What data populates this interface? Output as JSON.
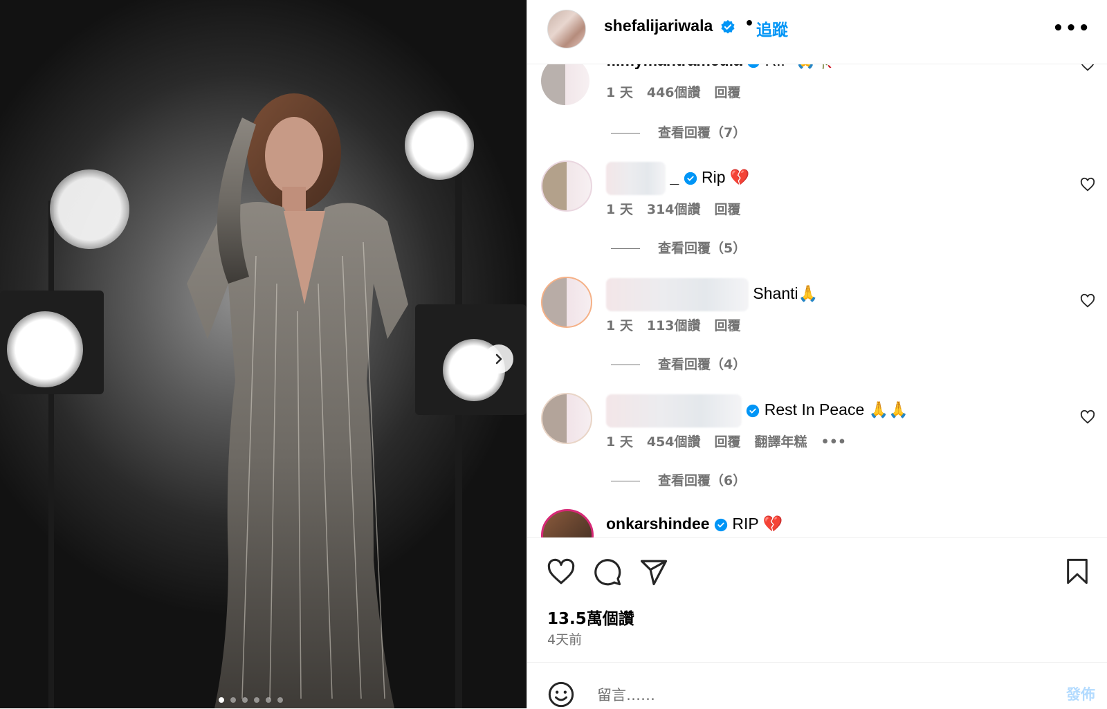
{
  "post": {
    "owner": "shefalijariwala",
    "follow_label": "追蹤",
    "separator": "•",
    "more_label": "•••",
    "likes": "13.5萬個讚",
    "posted": "4天前",
    "carousel_count": 6,
    "carousel_active": 1
  },
  "comments": [
    {
      "author": "filmymantramedia",
      "text": "RIP",
      "emoji": "🙏🥀",
      "time": "1 天",
      "likes": "446個讚",
      "reply": "回覆",
      "view_replies": "查看回覆（7）"
    },
    {
      "author": "_",
      "text": "Rip",
      "emoji": "💔",
      "time": "1 天",
      "likes": "314個讚",
      "reply": "回覆",
      "view_replies": "查看回覆（5）"
    },
    {
      "author": "",
      "text": "Shanti",
      "emoji": "🙏",
      "time": "1 天",
      "likes": "113個讚",
      "reply": "回覆",
      "view_replies": "查看回覆（4）"
    },
    {
      "author": "",
      "text": "Rest In Peace",
      "emoji": "🙏🙏",
      "time": "1 天",
      "likes": "454個讚",
      "reply": "回覆",
      "translate": "翻譯年糕",
      "more": "•••",
      "view_replies": "查看回覆（6）"
    },
    {
      "author": "onkarshindee",
      "text": "RIP",
      "emoji": "💔"
    }
  ],
  "composer": {
    "placeholder": "留言……",
    "post_label": "發佈"
  },
  "colors": {
    "accent": "#0095f6",
    "verified": "#0095f6",
    "muted": "#737373",
    "post_disabled": "#b3dbff"
  },
  "icons": [
    "verified-badge-icon",
    "more-icon",
    "heart-icon",
    "comment-icon",
    "share-icon",
    "bookmark-icon",
    "emoji-icon",
    "chevron-right-icon"
  ]
}
